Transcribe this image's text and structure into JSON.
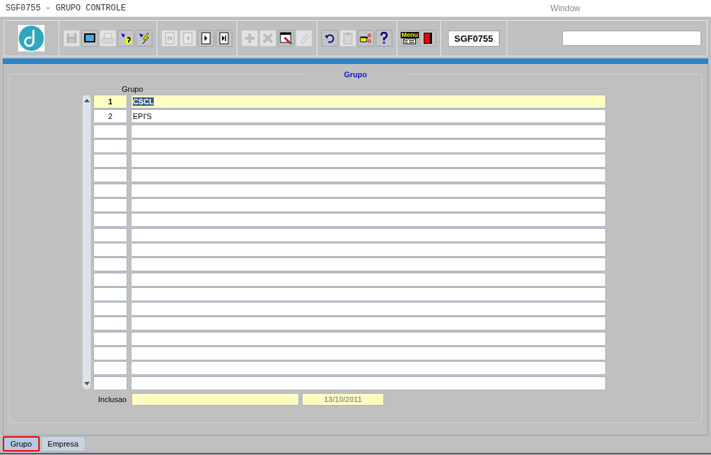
{
  "window": {
    "title": "SGF0755 - GRUPO CONTROLE",
    "menu": "Window"
  },
  "toolbar": {
    "groups": [
      [
        {
          "kind": "save",
          "disabled": true
        },
        {
          "kind": "screen",
          "disabled": false
        },
        {
          "kind": "print",
          "disabled": true
        },
        {
          "kind": "query",
          "disabled": false
        },
        {
          "kind": "execute",
          "disabled": false
        }
      ],
      [
        {
          "kind": "first",
          "disabled": true
        },
        {
          "kind": "previous",
          "disabled": true
        },
        {
          "kind": "next",
          "disabled": false
        },
        {
          "kind": "last",
          "disabled": false
        }
      ],
      [
        {
          "kind": "insert",
          "disabled": true
        },
        {
          "kind": "delete",
          "disabled": true
        },
        {
          "kind": "edit",
          "disabled": false
        },
        {
          "kind": "clear",
          "disabled": true
        }
      ],
      [
        {
          "kind": "undo",
          "disabled": false
        },
        {
          "kind": "paste",
          "disabled": true
        },
        {
          "kind": "hand",
          "disabled": false
        },
        {
          "kind": "help",
          "disabled": false
        }
      ],
      [
        {
          "kind": "menu",
          "label": "Menu",
          "disabled": false
        },
        {
          "kind": "exit",
          "disabled": false
        }
      ]
    ],
    "form_code": "SGF0755"
  },
  "section": {
    "title": "Grupo",
    "column_header": "Grupo",
    "rows": [
      {
        "number": "1",
        "name": "CSCL",
        "selected": true
      },
      {
        "number": "2",
        "name": "EPI'S",
        "selected": false
      },
      {
        "selected": false
      },
      {
        "selected": false
      },
      {
        "selected": false
      },
      {
        "selected": false
      },
      {
        "selected": false
      },
      {
        "selected": false
      },
      {
        "selected": false
      },
      {
        "selected": false
      },
      {
        "selected": false
      },
      {
        "selected": false
      },
      {
        "selected": false
      },
      {
        "selected": false
      },
      {
        "selected": false
      },
      {
        "selected": false
      },
      {
        "selected": false
      },
      {
        "selected": false
      },
      {
        "selected": false
      },
      {
        "selected": false
      }
    ],
    "inclusao": {
      "label": "Inclusao",
      "date": "13/10/2011"
    }
  },
  "tabs": [
    {
      "label": "Grupo",
      "selected": true
    },
    {
      "label": "Empresa",
      "selected": false
    }
  ]
}
